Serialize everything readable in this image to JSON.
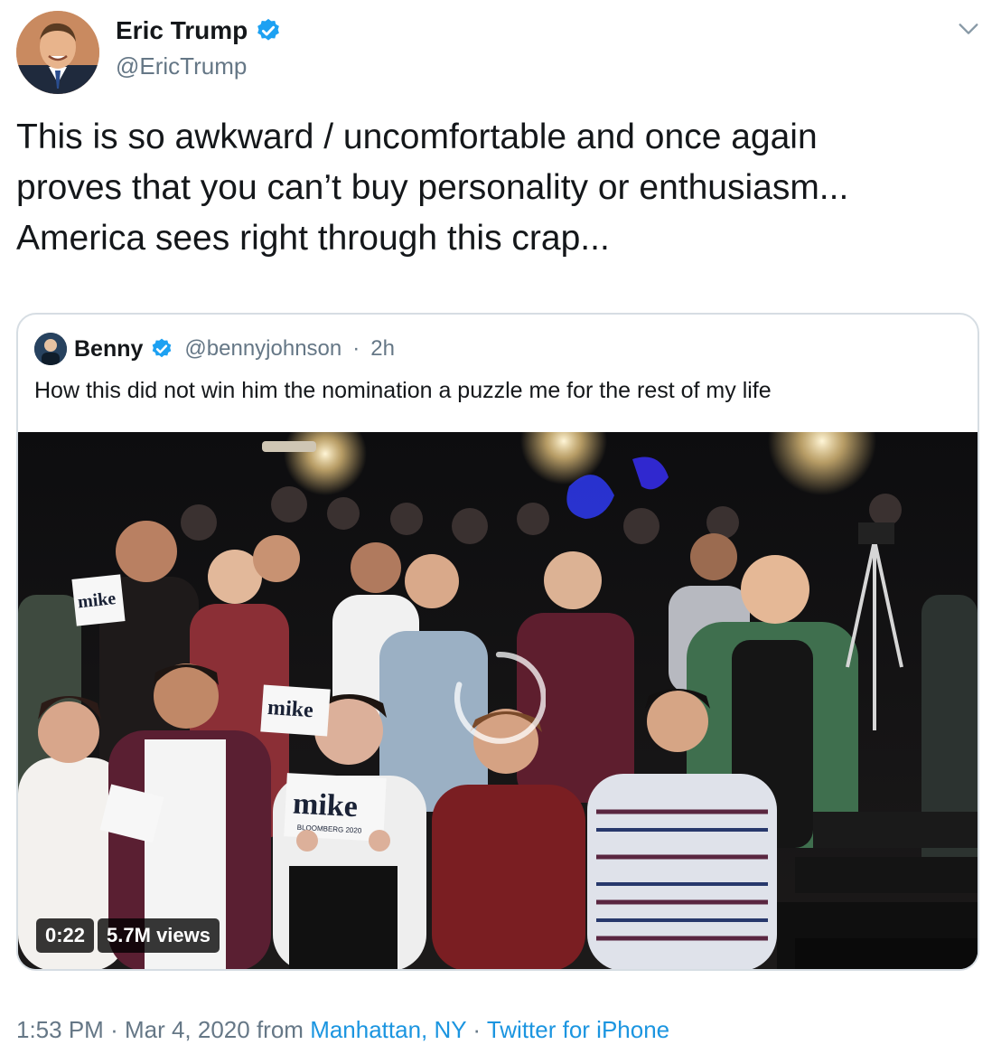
{
  "author": {
    "display_name": "Eric Trump",
    "handle": "@EricTrump",
    "verified_icon": "verified-badge-icon",
    "avatar_icon": "profile-photo"
  },
  "tweet": {
    "lines": [
      "This is so awkward / uncomfortable and once again",
      "proves that you can’t buy personality or enthusiasm...",
      "America sees right through this crap..."
    ]
  },
  "quoted": {
    "display_name": "Benny",
    "handle": "@bennyjohnson",
    "separator": "·",
    "time_ago": "2h",
    "text": "How this did not win him the nomination a puzzle me for the rest of my life",
    "video": {
      "duration": "0:22",
      "views": "5.7M views",
      "sign_text": "mike",
      "sign_subtext": "BLOOMBERG 2020"
    }
  },
  "footer": {
    "time": "1:53 PM",
    "sep1": "·",
    "date": "Mar 4, 2020",
    "from": "from",
    "location": "Manhattan, NY",
    "sep2": "·",
    "client": "Twitter for iPhone"
  },
  "colors": {
    "link": "#1b95e0",
    "secondary_text": "#657786",
    "verified": "#1da1f2",
    "border": "#d6dde3"
  }
}
